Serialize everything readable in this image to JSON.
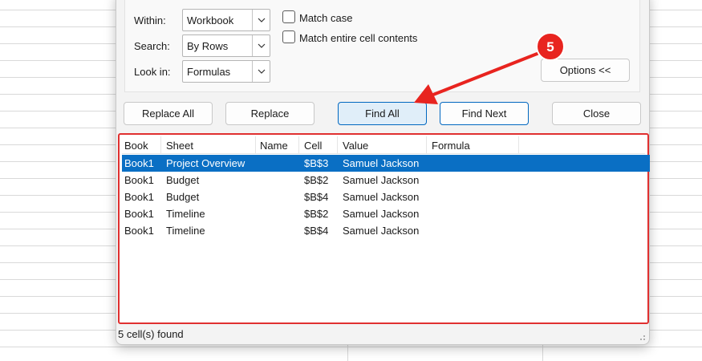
{
  "options": {
    "within_label": "Within:",
    "within_value": "Workbook",
    "search_label": "Search:",
    "search_value": "By Rows",
    "lookin_label": "Look in:",
    "lookin_value": "Formulas",
    "match_case_label": "Match case",
    "match_entire_label": "Match entire cell contents",
    "match_case_checked": false,
    "match_entire_checked": false,
    "options_button": "Options <<"
  },
  "buttons": {
    "replace_all": "Replace All",
    "replace": "Replace",
    "find_all": "Find All",
    "find_next": "Find Next",
    "close": "Close"
  },
  "results": {
    "columns": [
      "Book",
      "Sheet",
      "Name",
      "Cell",
      "Value",
      "Formula"
    ],
    "rows": [
      {
        "book": "Book1",
        "sheet": "Project Overview",
        "name": "",
        "cell": "$B$3",
        "value": "Samuel Jackson",
        "formula": "",
        "selected": true
      },
      {
        "book": "Book1",
        "sheet": "Budget",
        "name": "",
        "cell": "$B$2",
        "value": "Samuel Jackson",
        "formula": "",
        "selected": false
      },
      {
        "book": "Book1",
        "sheet": "Budget",
        "name": "",
        "cell": "$B$4",
        "value": "Samuel Jackson",
        "formula": "",
        "selected": false
      },
      {
        "book": "Book1",
        "sheet": "Timeline",
        "name": "",
        "cell": "$B$2",
        "value": "Samuel Jackson",
        "formula": "",
        "selected": false
      },
      {
        "book": "Book1",
        "sheet": "Timeline",
        "name": "",
        "cell": "$B$4",
        "value": "Samuel Jackson",
        "formula": "",
        "selected": false
      }
    ],
    "status": "5 cell(s) found"
  },
  "annotation": {
    "step_number": "5",
    "color": "#e8241f"
  },
  "colors": {
    "selection": "#0a6fc4",
    "highlight_border": "#e03030",
    "primary_border": "#0067c0"
  }
}
